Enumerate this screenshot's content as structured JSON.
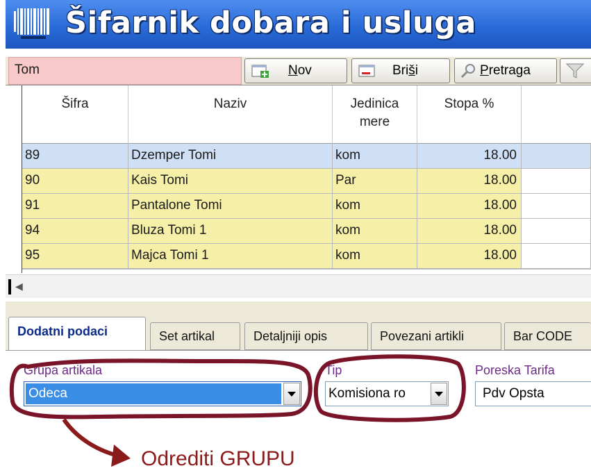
{
  "window": {
    "title": "Šifarnik dobara i usluga",
    "barcode_icon": "barcode-icon"
  },
  "toolbar": {
    "filter_value": "Tom",
    "buttons": [
      {
        "label_accel": "N",
        "label_rest": "ov",
        "icon": "new-document-icon"
      },
      {
        "label_pre": "Bri",
        "label_accel": "š",
        "label_rest": "i",
        "icon": "delete-document-icon"
      },
      {
        "label_accel": "P",
        "label_rest": "retraga",
        "icon": "magnifier-icon"
      }
    ],
    "filter_icon": "funnel-icon"
  },
  "grid": {
    "columns": [
      "Šifra",
      "Naziv",
      "Jedinica mere",
      "Stopa %"
    ],
    "column_header_lines": {
      "unit": [
        "Jedinica",
        "mere"
      ]
    },
    "rows": [
      {
        "sifra": "89",
        "naziv": "Dzemper Tomi",
        "jm": "kom",
        "stopa": "18.00",
        "selected": true
      },
      {
        "sifra": "90",
        "naziv": "Kais Tomi",
        "jm": "Par",
        "stopa": "18.00",
        "selected": false
      },
      {
        "sifra": "91",
        "naziv": "Pantalone Tomi",
        "jm": "kom",
        "stopa": "18.00",
        "selected": false
      },
      {
        "sifra": "94",
        "naziv": "Bluza Tomi 1",
        "jm": "kom",
        "stopa": "18.00",
        "selected": false
      },
      {
        "sifra": "95",
        "naziv": "Majca Tomi 1",
        "jm": "kom",
        "stopa": "18.00",
        "selected": false
      }
    ]
  },
  "tabs": [
    "Dodatni podaci",
    "Set artikal",
    "Detaljniji opis",
    "Povezani artikli",
    "Bar CODE"
  ],
  "active_tab": "Dodatni podaci",
  "form": {
    "grupa_label": "Grupa artikala",
    "grupa_value": "Odeca",
    "tip_label": "Tip",
    "tip_value": "Komisiona ro",
    "poreska_label": "Poreska Tarifa",
    "poreska_value": "Pdv Opsta"
  },
  "annotation": {
    "text": "Odrediti GRUPU",
    "color": "#8b1a1a"
  },
  "colors": {
    "title_blue": "#2a6bd8",
    "row_yellow": "#f6efa8",
    "row_selected": "#cfe0f6",
    "filter_pink": "#f7c9c9",
    "combo_highlight": "#3a8ee6",
    "label_purple": "#6a2a86"
  }
}
